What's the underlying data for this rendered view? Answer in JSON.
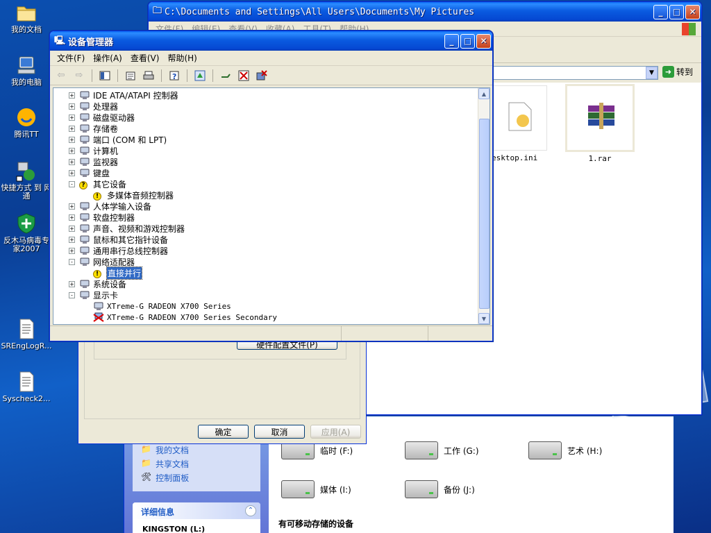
{
  "desktop": {
    "icons": [
      {
        "label": "我的文档"
      },
      {
        "label": "我的电脑"
      },
      {
        "label": "腾讯TT"
      },
      {
        "label": "快捷方式 到 网通"
      },
      {
        "label": "反木马病毒专家2007"
      },
      {
        "label": "SREngLogR..."
      },
      {
        "label": "Syscheck2..."
      }
    ]
  },
  "explorer": {
    "title": "C:\\Documents and Settings\\All Users\\Documents\\My Pictures",
    "menus": [
      "文件(F)",
      "编辑(E)",
      "查看(V)",
      "收藏(A)",
      "工具(T)",
      "帮助(H)"
    ],
    "go_label": "转到",
    "files": [
      {
        "name": "esktop.ini"
      },
      {
        "name": "1.rar"
      }
    ]
  },
  "props_dialog": {
    "hw_profile_button": "硬件配置文件(P)",
    "ok": "确定",
    "cancel": "取消",
    "apply": "应用(A)"
  },
  "mycomputer": {
    "links": [
      "我的文档",
      "共享文档",
      "控制面板"
    ],
    "details_title": "详细信息",
    "details_text": "KINGSTON (L:)",
    "drives": [
      {
        "label": "临时 (F:)"
      },
      {
        "label": "工作 (G:)"
      },
      {
        "label": "艺术 (H:)"
      },
      {
        "label": "媒体 (I:)"
      },
      {
        "label": "备份 (J:)"
      }
    ],
    "removable_header": "有可移动存储的设备"
  },
  "device_manager": {
    "title": "设备管理器",
    "menus": [
      "文件(F)",
      "操作(A)",
      "查看(V)",
      "帮助(H)"
    ],
    "tree": [
      {
        "label": "IDE ATA/ATAPI 控制器",
        "level": 1,
        "expander": "+",
        "icon": "disk-controller-icon"
      },
      {
        "label": "处理器",
        "level": 1,
        "expander": "+",
        "icon": "processor-icon"
      },
      {
        "label": "磁盘驱动器",
        "level": 1,
        "expander": "+",
        "icon": "disk-drive-icon"
      },
      {
        "label": "存储卷",
        "level": 1,
        "expander": "+",
        "icon": "storage-volume-icon"
      },
      {
        "label": "端口 (COM 和 LPT)",
        "level": 1,
        "expander": "+",
        "icon": "port-icon"
      },
      {
        "label": "计算机",
        "level": 1,
        "expander": "+",
        "icon": "computer-icon"
      },
      {
        "label": "监视器",
        "level": 1,
        "expander": "+",
        "icon": "monitor-icon"
      },
      {
        "label": "键盘",
        "level": 1,
        "expander": "+",
        "icon": "keyboard-icon"
      },
      {
        "label": "其它设备",
        "level": 1,
        "expander": "-",
        "icon": "unknown-device-icon"
      },
      {
        "label": "多媒体音频控制器",
        "level": 2,
        "expander": "",
        "icon": "warning-device-icon"
      },
      {
        "label": "人体学输入设备",
        "level": 1,
        "expander": "+",
        "icon": "hid-icon"
      },
      {
        "label": "软盘控制器",
        "level": 1,
        "expander": "+",
        "icon": "floppy-controller-icon"
      },
      {
        "label": "声音、视频和游戏控制器",
        "level": 1,
        "expander": "+",
        "icon": "sound-icon"
      },
      {
        "label": "鼠标和其它指针设备",
        "level": 1,
        "expander": "+",
        "icon": "mouse-icon"
      },
      {
        "label": "通用串行总线控制器",
        "level": 1,
        "expander": "+",
        "icon": "usb-icon"
      },
      {
        "label": "网络适配器",
        "level": 1,
        "expander": "-",
        "icon": "network-adapter-icon"
      },
      {
        "label": "直接并行",
        "level": 2,
        "expander": "",
        "icon": "network-warning-icon",
        "selected": true
      },
      {
        "label": "系统设备",
        "level": 1,
        "expander": "+",
        "icon": "system-device-icon"
      },
      {
        "label": "显示卡",
        "level": 1,
        "expander": "-",
        "icon": "display-adapter-icon"
      },
      {
        "label": "XTreme-G RADEON X700 Series",
        "level": 2,
        "expander": "",
        "icon": "display-device-icon"
      },
      {
        "label": "XTreme-G RADEON X700 Series Secondary",
        "level": 2,
        "expander": "",
        "icon": "disabled-display-icon"
      }
    ]
  },
  "colors": {
    "title_blue": "#0548d2",
    "selection": "#316ac5",
    "warning": "#ffe000"
  }
}
